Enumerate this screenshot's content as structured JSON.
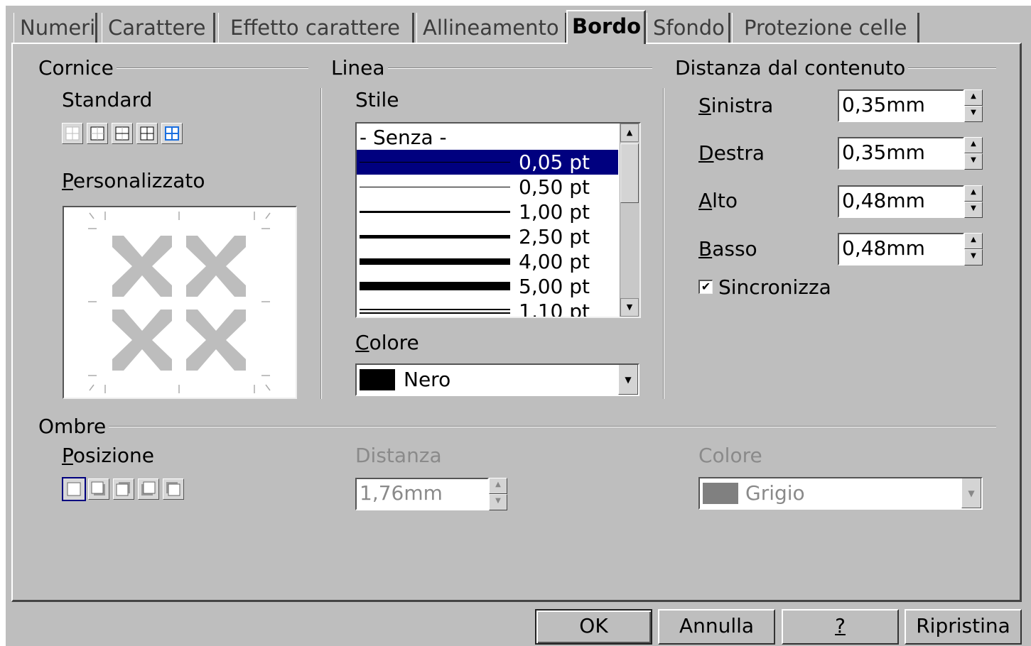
{
  "tabs": [
    "Numeri",
    "Carattere",
    "Effetto carattere",
    "Allineamento",
    "Bordo",
    "Sfondo",
    "Protezione celle"
  ],
  "active_tab": "Bordo",
  "cornice": {
    "title": "Cornice",
    "standard_label": "Standard",
    "custom_label": "Personalizzato",
    "presets": [
      "no-border-icon",
      "outer-border-icon",
      "outer-horizontal-icon",
      "outer-all-icon",
      "all-inner-icon"
    ]
  },
  "linea": {
    "title": "Linea",
    "stile_label": "Stile",
    "styles": [
      "- Senza -",
      "0,05 pt",
      "0,50 pt",
      "1,00 pt",
      "2,50 pt",
      "4,00 pt",
      "5,00 pt",
      "1,10 pt"
    ],
    "selected_style": "0,05 pt",
    "colore_label": "Colore",
    "colore_value": "Nero",
    "colore_swatch": "#000000"
  },
  "distanza": {
    "title": "Distanza dal contenuto",
    "sinistra_label": "Sinistra",
    "sinistra_value": "0,35mm",
    "destra_label": "Destra",
    "destra_value": "0,35mm",
    "alto_label": "Alto",
    "alto_value": "0,48mm",
    "basso_label": "Basso",
    "basso_value": "0,48mm",
    "sync_label": "Sincronizza",
    "sync_checked": true
  },
  "ombre": {
    "title": "Ombre",
    "posizione_label": "Posizione",
    "positions": [
      "no-shadow-icon",
      "shadow-bottom-right-icon",
      "shadow-top-right-icon",
      "shadow-bottom-left-icon",
      "shadow-top-left-icon"
    ],
    "distanza_label": "Distanza",
    "distanza_value": "1,76mm",
    "colore_label": "Colore",
    "colore_value": "Grigio",
    "colore_swatch": "#808080"
  },
  "buttons": {
    "ok": "OK",
    "annulla": "Annulla",
    "help": "?",
    "ripristina": "Ripristina"
  },
  "colors": {
    "dialog_bg": "#bebebe",
    "selection": "#00007f"
  }
}
